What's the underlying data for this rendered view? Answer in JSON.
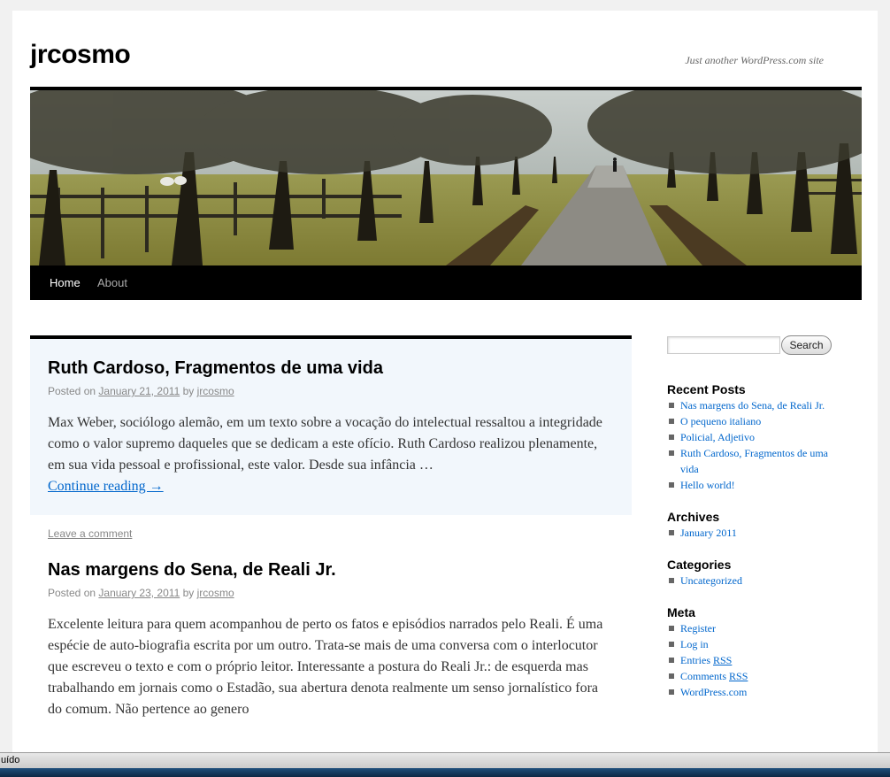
{
  "site": {
    "title": "jrcosmo",
    "description": "Just another WordPress.com site"
  },
  "nav": {
    "items": [
      {
        "label": "Home",
        "current": true
      },
      {
        "label": "About",
        "current": false
      }
    ]
  },
  "posts": [
    {
      "title": "Ruth Cardoso, Fragmentos de uma vida",
      "posted_on_label": "Posted on",
      "date": "January 21, 2011",
      "by_label": "by",
      "author": "jrcosmo",
      "summary": "Max Weber, sociólogo alemão, em um texto sobre a vocação do intelectual ressaltou a integridade como o valor supremo daqueles que se dedicam a este ofício. Ruth Cardoso realizou plenamente, em sua vida pessoal e profissional, este valor. Desde sua infância …",
      "more_link": "Continue reading →",
      "comment_link": "Leave a comment"
    },
    {
      "title": "Nas margens do Sena, de Reali Jr.",
      "posted_on_label": "Posted on",
      "date": "January 23, 2011",
      "by_label": "by",
      "author": "jrcosmo",
      "summary": "Excelente leitura para quem acompanhou de perto os fatos e episódios narrados pelo Reali. É uma espécie de auto-biografia escrita por um outro. Trata-se mais de uma conversa com o interlocutor que escreveu o texto e com o próprio leitor. Interessante a postura do Reali Jr.: de esquerda mas trabalhando em jornais como o Estadão, sua abertura denota realmente um senso jornalístico fora do comum. Não pertence ao genero"
    }
  ],
  "sidebar": {
    "search": {
      "placeholder": "",
      "button_label": "Search"
    },
    "recent_posts": {
      "title": "Recent Posts",
      "items": [
        "Nas margens do Sena, de Reali Jr.",
        "O pequeno italiano",
        "Policial, Adjetivo",
        "Ruth Cardoso, Fragmentos de uma vida",
        "Hello world!"
      ]
    },
    "archives": {
      "title": "Archives",
      "items": [
        "January 2011"
      ]
    },
    "categories": {
      "title": "Categories",
      "items": [
        "Uncategorized"
      ]
    },
    "meta": {
      "title": "Meta",
      "items": [
        "Register",
        "Log in",
        "Entries",
        "Comments",
        "WordPress.com"
      ],
      "rss_label": "RSS"
    }
  },
  "statusbar": {
    "text": "uído"
  },
  "icons": {
    "header": "tree-lined-path-photo"
  }
}
